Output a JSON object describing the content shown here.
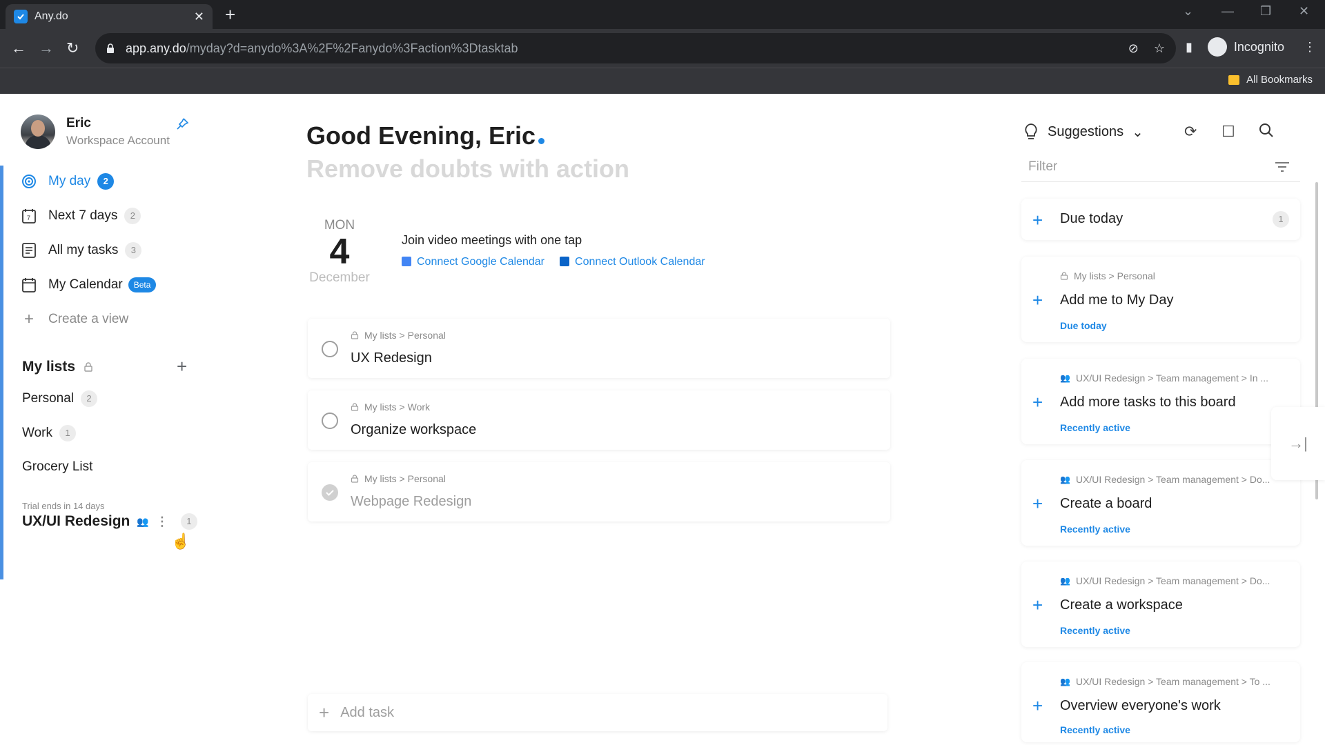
{
  "browser": {
    "tab_title": "Any.do",
    "url_host": "app.any.do",
    "url_path": "/myday?d=anydo%3A%2F%2Fanydo%3Faction%3Dtasktab",
    "incognito_label": "Incognito",
    "bookmarks_label": "All Bookmarks"
  },
  "profile": {
    "name": "Eric",
    "account": "Workspace Account"
  },
  "nav": {
    "my_day": {
      "label": "My day",
      "count": "2"
    },
    "next7": {
      "label": "Next 7 days",
      "count": "2"
    },
    "all_tasks": {
      "label": "All my tasks",
      "count": "3"
    },
    "calendar": {
      "label": "My Calendar",
      "badge": "Beta"
    },
    "create_view": {
      "label": "Create a view"
    }
  },
  "lists": {
    "heading": "My lists",
    "items": [
      {
        "label": "Personal",
        "count": "2"
      },
      {
        "label": "Work",
        "count": "1"
      },
      {
        "label": "Grocery List",
        "count": ""
      }
    ],
    "trial_note": "Trial ends in 14 days",
    "workspace": {
      "label": "UX/UI Redesign",
      "count": "1"
    }
  },
  "main": {
    "greeting": "Good Evening, Eric",
    "motto": "Remove doubts with action",
    "date": {
      "dow": "MON",
      "day": "4",
      "month": "December"
    },
    "meetings": {
      "title": "Join video meetings with one tap",
      "google": "Connect Google Calendar",
      "outlook": "Connect Outlook Calendar"
    },
    "tasks": [
      {
        "path": "My lists > Personal",
        "title": "UX Redesign",
        "done": false
      },
      {
        "path": "My lists > Work",
        "title": "Organize workspace",
        "done": false
      },
      {
        "path": "My lists > Personal",
        "title": "Webpage Redesign",
        "done": true
      }
    ],
    "add_task_placeholder": "Add task"
  },
  "suggestions": {
    "title": "Suggestions",
    "filter_placeholder": "Filter",
    "due_today": {
      "label": "Due today",
      "count": "1"
    },
    "cards": [
      {
        "path": "My lists > Personal",
        "title": "Add me to My Day",
        "tag": "Due today"
      },
      {
        "path": "UX/UI Redesign > Team management > In ...",
        "title": "Add more tasks to this board",
        "tag": "Recently active"
      },
      {
        "path": "UX/UI Redesign > Team management > Do...",
        "title": "Create a board",
        "tag": "Recently active"
      },
      {
        "path": "UX/UI Redesign > Team management > Do...",
        "title": "Create a workspace",
        "tag": "Recently active"
      },
      {
        "path": "UX/UI Redesign > Team management > To ...",
        "title": "Overview everyone's work",
        "tag": "Recently active"
      }
    ]
  },
  "colors": {
    "accent": "#1e88e5",
    "sidebar_accent": "#4a90e2"
  }
}
